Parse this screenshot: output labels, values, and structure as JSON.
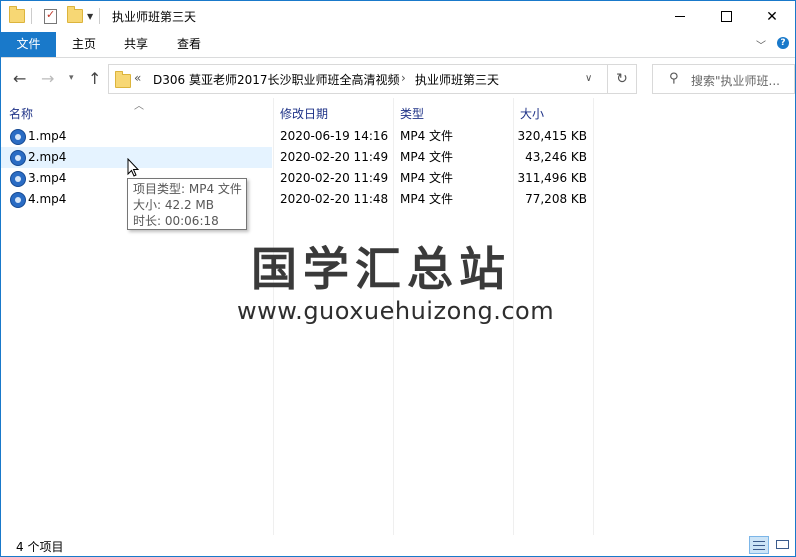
{
  "window": {
    "title": "执业师班第三天"
  },
  "ribbon": {
    "tabs": [
      "文件",
      "主页",
      "共享",
      "查看"
    ]
  },
  "address": {
    "overflow": "«",
    "segments": [
      "D306 莫亚老师2017长沙职业师班全高清视频",
      "执业师班第三天"
    ]
  },
  "search": {
    "placeholder": "搜索\"执业师班..."
  },
  "columns": {
    "name": "名称",
    "date": "修改日期",
    "type": "类型",
    "size": "大小"
  },
  "files": [
    {
      "name": "1.mp4",
      "date": "2020-06-19 14:16",
      "type": "MP4 文件",
      "size": "320,415 KB"
    },
    {
      "name": "2.mp4",
      "date": "2020-02-20 11:49",
      "type": "MP4 文件",
      "size": "43,246 KB"
    },
    {
      "name": "3.mp4",
      "date": "2020-02-20 11:49",
      "type": "MP4 文件",
      "size": "311,496 KB"
    },
    {
      "name": "4.mp4",
      "date": "2020-02-20 11:48",
      "type": "MP4 文件",
      "size": "77,208 KB"
    }
  ],
  "tooltip": {
    "type": "项目类型: MP4 文件",
    "size": "大小: 42.2 MB",
    "duration": "时长: 00:06:18"
  },
  "watermark": {
    "cn": "国学汇总站",
    "url": "www.guoxuehuizong.com"
  },
  "status": {
    "count": "4 个项目"
  },
  "colors": {
    "accent": "#1979ca",
    "header_text": "#1e3287",
    "hover_row": "#e5f3ff"
  },
  "icons": {
    "qat": [
      "folder-icon",
      "properties-check-icon",
      "new-folder-icon",
      "dropdown-icon"
    ],
    "file": "mp4-video-icon",
    "nav": [
      "back-arrow-icon",
      "forward-arrow-icon",
      "recent-dropdown-icon",
      "up-arrow-icon",
      "refresh-icon",
      "search-icon"
    ]
  }
}
